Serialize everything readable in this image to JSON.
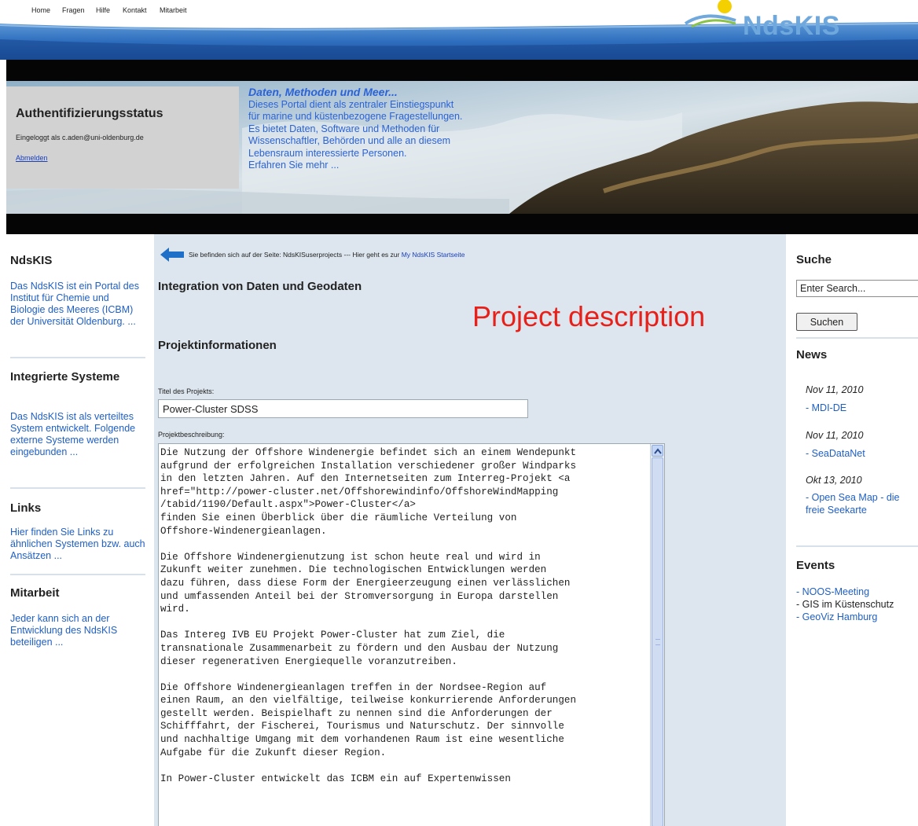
{
  "nav": {
    "home": "Home",
    "fragen": "Fragen",
    "hilfe": "Hilfe",
    "kontakt": "Kontakt",
    "mitarbeit": "Mitarbeit"
  },
  "logo": {
    "text": "NdsKIS"
  },
  "auth": {
    "title": "Authentifizierungsstatus",
    "logged_in": "Eingeloggt als  c.aden@uni-oldenburg.de",
    "logout": "Abmelden"
  },
  "hero": {
    "heading": "Daten, Methoden und Meer...",
    "lines": [
      "Dieses Portal dient als zentraler Einstiegspunkt",
      "für marine und küstenbezogene Fragestellungen.",
      "Es bietet Daten, Software und Methoden für",
      "Wissenschaftler, Behörden und alle an diesem",
      "Lebensraum interessierte Personen.",
      "Erfahren Sie mehr ..."
    ]
  },
  "left_sidebar": {
    "sections": [
      {
        "heading": "NdsKIS",
        "text": "Das NdsKIS ist ein Portal des Institut für Chemie und Biologie des Meeres (ICBM) der Universität Oldenburg. ..."
      },
      {
        "heading": "Integrierte Systeme",
        "text": "Das NdsKIS ist als verteiltes System entwickelt. Folgende externe Systeme werden eingebunden ..."
      },
      {
        "heading": "Links",
        "text": "Hier finden Sie Links zu ähnlichen Systemen bzw. auch Ansätzen ..."
      },
      {
        "heading": "Mitarbeit",
        "text": "Jeder kann sich an der Entwicklung des NdsKIS beteiligen ..."
      }
    ]
  },
  "main": {
    "breadcrumb_prefix": "Sie befinden sich auf der Seite: NdsKISuserprojects  ---  Hier geht es zur ",
    "breadcrumb_link": "My NdsKIS Startseite",
    "page_title": "Integration von Daten und Geodaten",
    "annotation": "Project description",
    "section_title": "Projektinformationen",
    "title_label": "Titel des Projekts:",
    "title_value": "Power-Cluster SDSS",
    "desc_label": "Projektbeschreibung:",
    "description": "Die Nutzung der Offshore Windenergie befindet sich an einem Wendepunkt\naufgrund der erfolgreichen Installation verschiedener großer Windparks\nin den letzten Jahren. Auf den Internetseiten zum Interreg-Projekt <a\nhref=\"http://power-cluster.net/Offshorewindinfo/OffshoreWindMapping\n/tabid/1190/Default.aspx\">Power-Cluster</a>\nfinden Sie einen Überblick über die räumliche Verteilung von\nOffshore-Windenergieanlagen.\n\nDie Offshore Windenergienutzung ist schon heute real und wird in\nZukunft weiter zunehmen. Die technologischen Entwicklungen werden\ndazu führen, dass diese Form der Energieerzeugung einen verlässlichen\nund umfassenden Anteil bei der Stromversorgung in Europa darstellen\nwird.\n\nDas Intereg IVB EU Projekt Power-Cluster hat zum Ziel, die\ntransnationale Zusammenarbeit zu fördern und den Ausbau der Nutzung\ndieser regenerativen Energiequelle voranzutreiben.\n\nDie Offshore Windenergieanlagen treffen in der Nordsee-Region auf\neinen Raum, an den vielfältige, teilweise konkurrierende Anforderungen\ngestellt werden. Beispielhaft zu nennen sind die Anforderungen der\nSchifffahrt, der Fischerei, Tourismus und Naturschutz. Der sinnvolle\nund nachhaltige Umgang mit dem vorhandenen Raum ist eine wesentliche\nAufgabe für die Zukunft dieser Region.\n\nIn Power-Cluster entwickelt das ICBM ein auf Expertenwissen"
  },
  "right_sidebar": {
    "search_heading": "Suche",
    "search_placeholder": "Enter Search...",
    "search_button": "Suchen",
    "news_heading": "News",
    "news": [
      {
        "date": "Nov 11, 2010",
        "title": "- MDI-DE"
      },
      {
        "date": "Nov 11, 2010",
        "title": "- SeaDataNet"
      },
      {
        "date": "Okt 13, 2010",
        "title": "- Open Sea Map - die freie Seekarte"
      }
    ],
    "events_heading": "Events",
    "events": [
      {
        "title": "- NOOS-Meeting",
        "link": true
      },
      {
        "title": "- GIS im Küstenschutz",
        "link": false
      },
      {
        "title": "- GeoViz Hamburg",
        "link": true
      }
    ]
  },
  "colors": {
    "link_blue": "#1f5fc4",
    "hero_text": "#2b63d6",
    "annotation_red": "#e8201a",
    "content_bg": "#dde6ee"
  }
}
